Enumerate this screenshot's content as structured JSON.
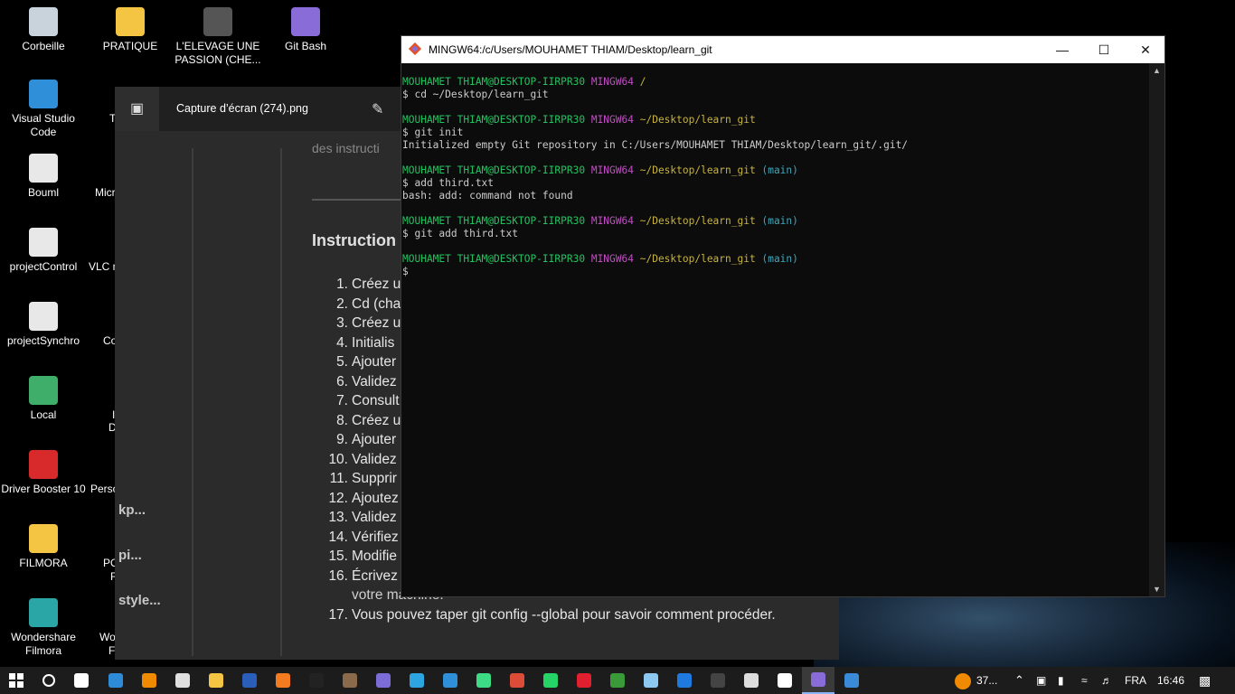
{
  "desktop": {
    "icons_left": [
      {
        "label": "Corbeille",
        "icon": "recycle-bin-icon"
      },
      {
        "label": "Visual Studio Code",
        "icon": "vscode-icon"
      },
      {
        "label": "Bouml",
        "icon": "bouml-icon"
      },
      {
        "label": "projectControl",
        "icon": "project-control-icon"
      },
      {
        "label": "projectSynchro",
        "icon": "project-synchro-icon"
      },
      {
        "label": "Local",
        "icon": "local-icon"
      },
      {
        "label": "Driver Booster 10",
        "icon": "driver-booster-icon"
      },
      {
        "label": "FILMORA",
        "icon": "folder-icon"
      },
      {
        "label": "Wondershare Filmora",
        "icon": "filmora-icon"
      }
    ],
    "icons_top": [
      {
        "label": "PRATIQUE",
        "icon": "folder-icon"
      },
      {
        "label": "L'ELEVAGE UNE PASSION (CHE...",
        "icon": "video-icon"
      },
      {
        "label": "Git Bash",
        "icon": "git-bash-icon"
      }
    ],
    "icons_col2_partial": [
      {
        "label": "Te"
      },
      {
        "label": "Micr"
      },
      {
        "label": "VLC m"
      },
      {
        "label": "Co"
      },
      {
        "label": "I"
      },
      {
        "label": "D"
      },
      {
        "label": "Perso"
      },
      {
        "label": "PO"
      },
      {
        "label": "R"
      },
      {
        "label": "Wo"
      },
      {
        "label": "Fi"
      }
    ]
  },
  "viewer": {
    "title": "Capture d’écran (274).png",
    "side_items": [
      "kp...",
      "pi...",
      "style..."
    ],
    "doc_faded": "des instructi",
    "heading": "Instruction",
    "list": [
      {
        "num": "1.",
        "text": "Créez u"
      },
      {
        "num": "2.",
        "text": "Cd (cha"
      },
      {
        "num": "3.",
        "text": "Créez u"
      },
      {
        "num": "4.",
        "text": "Initialis"
      },
      {
        "num": "5.",
        "text": "Ajouter"
      },
      {
        "num": "6.",
        "text": "Validez"
      },
      {
        "num": "7.",
        "text": "Consult"
      },
      {
        "num": "8.",
        "text": "Créez u"
      },
      {
        "num": "9.",
        "text": "Ajouter"
      },
      {
        "num": "10.",
        "text": "Validez"
      },
      {
        "num": "11.",
        "text": "Supprir"
      },
      {
        "num": "12.",
        "text": "Ajoutez"
      },
      {
        "num": "13.",
        "text": "Validez"
      },
      {
        "num": "14.",
        "text": "Vérifiez"
      },
      {
        "num": "15.",
        "text": "Modifie"
      },
      {
        "num": "16.",
        "text": "Écrivez"
      }
    ],
    "list_continuation": "votre machine.",
    "last_item": {
      "num": "17.",
      "text": "Vous pouvez taper git config --global pour savoir comment procéder."
    }
  },
  "terminal": {
    "title": "MINGW64:/c/Users/MOUHAMET THIAM/Desktop/learn_git",
    "user": "MOUHAMET THIAM@DESKTOP-IIRPR30",
    "env": "MINGW64",
    "blocks": [
      {
        "path": "/",
        "branch": "",
        "cmd": "$ cd ~/Desktop/learn_git",
        "out": ""
      },
      {
        "path": "~/Desktop/learn_git",
        "branch": "",
        "cmd": "$ git init",
        "out": "Initialized empty Git repository in C:/Users/MOUHAMET THIAM/Desktop/learn_git/.git/"
      },
      {
        "path": "~/Desktop/learn_git",
        "branch": "(main)",
        "cmd": "$ add third.txt",
        "out": "bash: add: command not found"
      },
      {
        "path": "~/Desktop/learn_git",
        "branch": "(main)",
        "cmd": "$ git add third.txt",
        "out": ""
      },
      {
        "path": "~/Desktop/learn_git",
        "branch": "(main)",
        "cmd": "$",
        "out": ""
      }
    ]
  },
  "taskbar": {
    "apps": [
      {
        "name": "search-icon",
        "color": "#ffffff"
      },
      {
        "name": "task-view-icon",
        "color": "#ffffff"
      },
      {
        "name": "control-panel-icon",
        "color": "#2e8bd8"
      },
      {
        "name": "vlc-icon",
        "color": "#f08a00"
      },
      {
        "name": "settings-icon",
        "color": "#e0e0e0"
      },
      {
        "name": "file-explorer-icon",
        "color": "#f4c542"
      },
      {
        "name": "word-icon",
        "color": "#2b5eb8"
      },
      {
        "name": "app-orange-icon",
        "color": "#f47b20"
      },
      {
        "name": "app-dark-icon",
        "color": "#222222"
      },
      {
        "name": "app-photo-icon",
        "color": "#8a6a4a"
      },
      {
        "name": "app-purple-icon",
        "color": "#7b6cd8"
      },
      {
        "name": "telegram-icon",
        "color": "#2ca5e0"
      },
      {
        "name": "vscode-taskbar-icon",
        "color": "#2f8fd8"
      },
      {
        "name": "android-studio-icon",
        "color": "#3ddc84"
      },
      {
        "name": "chrome-icon",
        "color": "#dd4b39"
      },
      {
        "name": "whatsapp-icon",
        "color": "#25d366"
      },
      {
        "name": "opera-icon",
        "color": "#e0202e"
      },
      {
        "name": "app-green-icon",
        "color": "#3a9a3a"
      },
      {
        "name": "notepad-icon",
        "color": "#8cc8f0"
      },
      {
        "name": "app-blue-icon",
        "color": "#1f7adf"
      },
      {
        "name": "terminal-icon",
        "color": "#444444"
      },
      {
        "name": "app-window-icon",
        "color": "#dddddd"
      },
      {
        "name": "github-icon",
        "color": "#ffffff"
      },
      {
        "name": "git-bash-taskbar-icon",
        "color": "#8a6cd8"
      },
      {
        "name": "photos-icon",
        "color": "#3a8ad8"
      }
    ],
    "weather": "37...",
    "language": "FRA",
    "time": "16:46"
  },
  "colors": {
    "prompt_user": "#21c45e",
    "prompt_env": "#c14ec4",
    "prompt_path": "#c8b33a",
    "prompt_branch": "#3fa6b9"
  }
}
